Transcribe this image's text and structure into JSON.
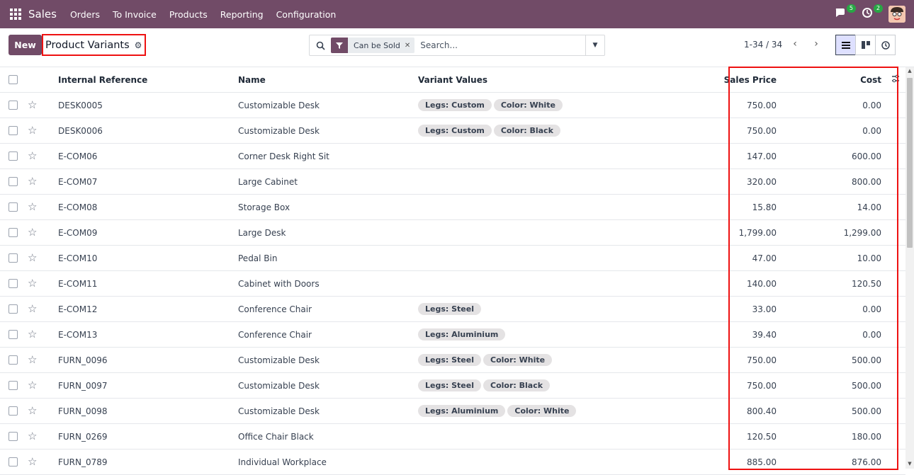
{
  "nav": {
    "brand": "Sales",
    "items": [
      "Orders",
      "To Invoice",
      "Products",
      "Reporting",
      "Configuration"
    ],
    "messages_count": "5",
    "activities_count": "2"
  },
  "control_panel": {
    "new_label": "New",
    "title": "Product Variants",
    "facet_label": "Can be Sold",
    "search_placeholder": "Search...",
    "pager": "1-34 / 34"
  },
  "table": {
    "headers": {
      "internal_reference": "Internal Reference",
      "name": "Name",
      "variant_values": "Variant Values",
      "sales_price": "Sales Price",
      "cost": "Cost"
    },
    "rows": [
      {
        "ref": "DESK0005",
        "name": "Customizable Desk",
        "variants": [
          "Legs: Custom",
          "Color: White"
        ],
        "price": "750.00",
        "cost": "0.00"
      },
      {
        "ref": "DESK0006",
        "name": "Customizable Desk",
        "variants": [
          "Legs: Custom",
          "Color: Black"
        ],
        "price": "750.00",
        "cost": "0.00"
      },
      {
        "ref": "E-COM06",
        "name": "Corner Desk Right Sit",
        "variants": [],
        "price": "147.00",
        "cost": "600.00"
      },
      {
        "ref": "E-COM07",
        "name": "Large Cabinet",
        "variants": [],
        "price": "320.00",
        "cost": "800.00"
      },
      {
        "ref": "E-COM08",
        "name": "Storage Box",
        "variants": [],
        "price": "15.80",
        "cost": "14.00"
      },
      {
        "ref": "E-COM09",
        "name": "Large Desk",
        "variants": [],
        "price": "1,799.00",
        "cost": "1,299.00"
      },
      {
        "ref": "E-COM10",
        "name": "Pedal Bin",
        "variants": [],
        "price": "47.00",
        "cost": "10.00"
      },
      {
        "ref": "E-COM11",
        "name": "Cabinet with Doors",
        "variants": [],
        "price": "140.00",
        "cost": "120.50"
      },
      {
        "ref": "E-COM12",
        "name": "Conference Chair",
        "variants": [
          "Legs: Steel"
        ],
        "price": "33.00",
        "cost": "0.00"
      },
      {
        "ref": "E-COM13",
        "name": "Conference Chair",
        "variants": [
          "Legs: Aluminium"
        ],
        "price": "39.40",
        "cost": "0.00"
      },
      {
        "ref": "FURN_0096",
        "name": "Customizable Desk",
        "variants": [
          "Legs: Steel",
          "Color: White"
        ],
        "price": "750.00",
        "cost": "500.00"
      },
      {
        "ref": "FURN_0097",
        "name": "Customizable Desk",
        "variants": [
          "Legs: Steel",
          "Color: Black"
        ],
        "price": "750.00",
        "cost": "500.00"
      },
      {
        "ref": "FURN_0098",
        "name": "Customizable Desk",
        "variants": [
          "Legs: Aluminium",
          "Color: White"
        ],
        "price": "800.40",
        "cost": "500.00"
      },
      {
        "ref": "FURN_0269",
        "name": "Office Chair Black",
        "variants": [],
        "price": "120.50",
        "cost": "180.00"
      },
      {
        "ref": "FURN_0789",
        "name": "Individual Workplace",
        "variants": [],
        "price": "885.00",
        "cost": "876.00"
      }
    ]
  },
  "colors": {
    "brand": "#714b67",
    "highlight": "#ee1111"
  }
}
